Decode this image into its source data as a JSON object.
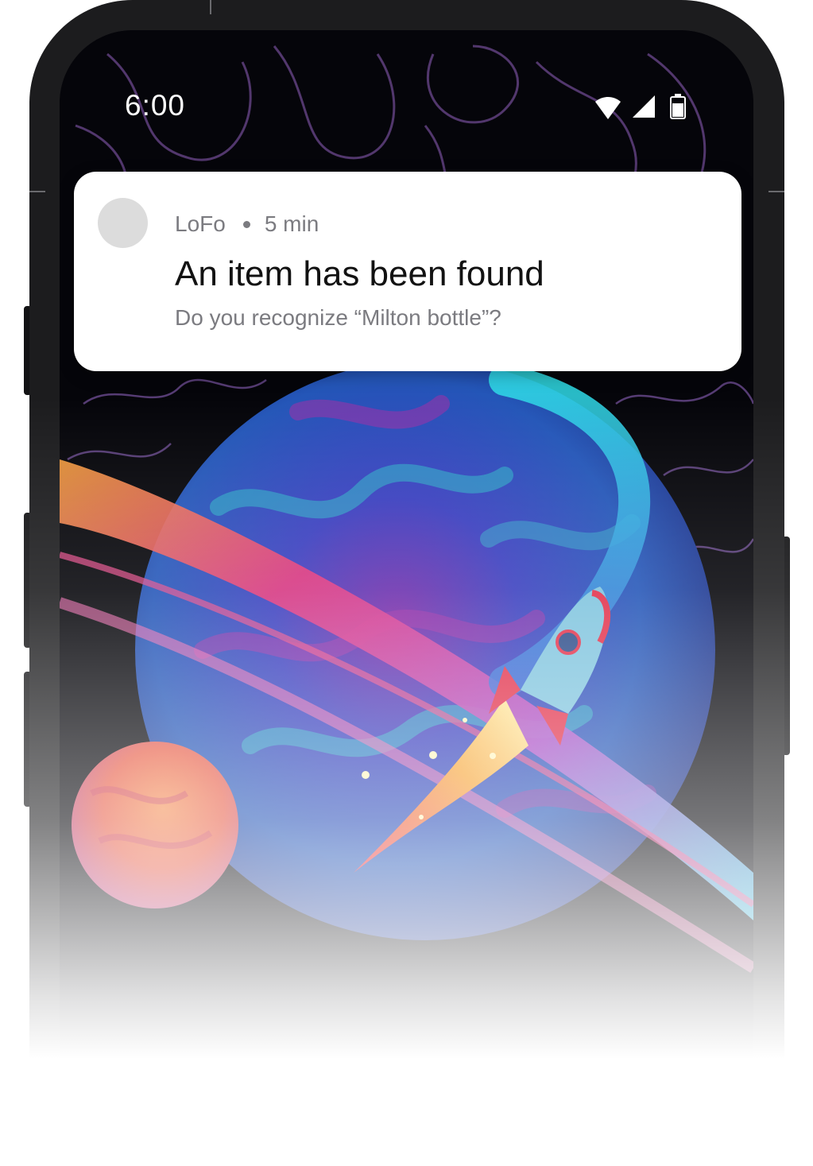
{
  "status_bar": {
    "time": "6:00",
    "icons": [
      "wifi-icon",
      "cellular-signal-icon",
      "battery-icon"
    ]
  },
  "notification": {
    "app_name": "LoFo",
    "timestamp": "5 min",
    "title": "An item has been found",
    "body": "Do you recognize “Milton bottle”?"
  },
  "wallpaper": {
    "subject": "space illustration",
    "colors": {
      "background": "#05050a",
      "planet_blue": "#2f3fb0",
      "planet_magenta": "#8a2c9a",
      "ring_cyan": "#37d2e6",
      "small_planet": "#e8604a",
      "rocket_red": "#e2304a",
      "rocket_body": "#7fc4de"
    }
  }
}
